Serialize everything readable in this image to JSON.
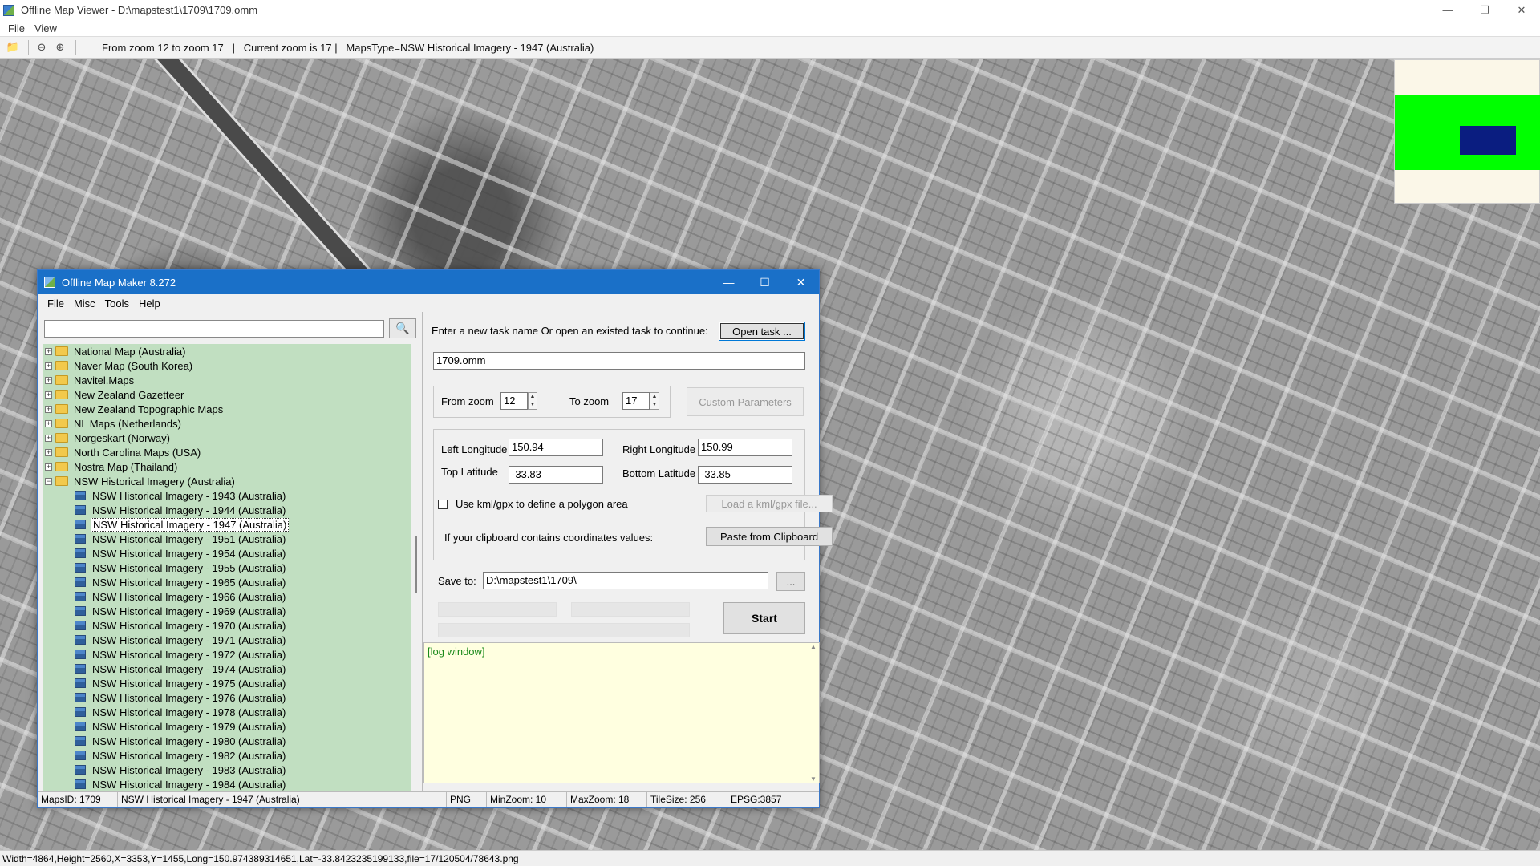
{
  "viewer": {
    "title": "Offline Map Viewer - D:\\mapstest1\\1709\\1709.omm",
    "menu": [
      "File",
      "View"
    ],
    "toolbar_info": "From zoom 12 to zoom 17   |   Current zoom is 17 |   MapsType=NSW Historical Imagery - 1947 (Australia)",
    "status": "Width=4864,Height=2560,X=3353,Y=1455,Long=150.974389314651,Lat=-33.8423235199133,file=17/120504/78643.png"
  },
  "dialog": {
    "title": "Offline Map Maker 8.272",
    "menu": [
      "File",
      "Misc",
      "Tools",
      "Help"
    ],
    "search": {
      "value": "",
      "placeholder": ""
    },
    "tree": {
      "folders": [
        "National Map (Australia)",
        "Naver Map (South Korea)",
        "Navitel.Maps",
        "New Zealand Gazetteer",
        "New Zealand Topographic Maps",
        "NL Maps (Netherlands)",
        "Norgeskart (Norway)",
        "North Carolina Maps (USA)",
        "Nostra Map (Thailand)"
      ],
      "open_folder": "NSW Historical Imagery (Australia)",
      "children": [
        "NSW Historical Imagery - 1943 (Australia)",
        "NSW Historical Imagery - 1944 (Australia)",
        "NSW Historical Imagery - 1947 (Australia)",
        "NSW Historical Imagery - 1951 (Australia)",
        "NSW Historical Imagery - 1954 (Australia)",
        "NSW Historical Imagery - 1955 (Australia)",
        "NSW Historical Imagery - 1965 (Australia)",
        "NSW Historical Imagery - 1966 (Australia)",
        "NSW Historical Imagery - 1969 (Australia)",
        "NSW Historical Imagery - 1970 (Australia)",
        "NSW Historical Imagery - 1971 (Australia)",
        "NSW Historical Imagery - 1972 (Australia)",
        "NSW Historical Imagery - 1974 (Australia)",
        "NSW Historical Imagery - 1975 (Australia)",
        "NSW Historical Imagery - 1976 (Australia)",
        "NSW Historical Imagery - 1978 (Australia)",
        "NSW Historical Imagery - 1979 (Australia)",
        "NSW Historical Imagery - 1980 (Australia)",
        "NSW Historical Imagery - 1982 (Australia)",
        "NSW Historical Imagery - 1983 (Australia)",
        "NSW Historical Imagery - 1984 (Australia)"
      ],
      "selected_child": "NSW Historical Imagery - 1947 (Australia)"
    },
    "task_prompt": "Enter a new task name Or open an existed task to continue:",
    "open_task_label": "Open task ...",
    "task_name": "1709.omm",
    "from_zoom_label": "From zoom",
    "from_zoom": "12",
    "to_zoom_label": "To zoom",
    "to_zoom": "17",
    "custom_params_label": "Custom Parameters",
    "left_lon_label": "Left Longitude",
    "left_lon": "150.94",
    "right_lon_label": "Right Longitude",
    "right_lon": "150.99",
    "top_lat_label": "Top Latitude",
    "top_lat": "-33.83",
    "bottom_lat_label": "Bottom Latitude",
    "bottom_lat": "-33.85",
    "kml_check_label": "Use kml/gpx to define a polygon area",
    "load_kml_label": "Load a kml/gpx file...",
    "clipboard_prompt": "If your clipboard contains coordinates values:",
    "paste_label": "Paste from Clipboard",
    "save_to_label": "Save to:",
    "save_to": "D:\\mapstest1\\1709\\",
    "browse_label": "...",
    "start_label": "Start",
    "log_text": "[log window]",
    "status": {
      "maps_id": "MapsID: 1709",
      "maps_name": "NSW Historical Imagery - 1947 (Australia)",
      "format": "PNG",
      "min_zoom": "MinZoom: 10",
      "max_zoom": "MaxZoom: 18",
      "tile_size": "TileSize: 256",
      "epsg": "EPSG:3857"
    }
  },
  "colors": {
    "title_blue": "#1a70c8",
    "tree_bg": "#c1dfc1",
    "log_bg": "#ffffe0",
    "minimap_green": "#00ff00",
    "minimap_blue": "#0a1d80"
  }
}
